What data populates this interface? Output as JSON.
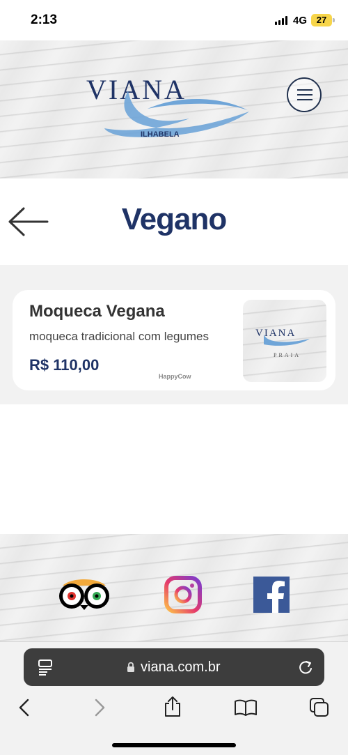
{
  "status_bar": {
    "time": "2:13",
    "network": "4G",
    "battery": "27"
  },
  "header": {
    "logo_text": "VIANA",
    "logo_sub": "ILHABELA",
    "menu_icon": "hamburger-icon"
  },
  "page": {
    "title": "Vegano",
    "back_icon": "arrow-left-icon"
  },
  "items": [
    {
      "name": "Moqueca Vegana",
      "description": "moqueca tradicional com legumes",
      "price": "R$ 110,00",
      "thumb_logo": "VIANA",
      "thumb_sub": "PRAIA",
      "watermark": "HappyCow"
    }
  ],
  "footer": {
    "social": [
      "tripadvisor-icon",
      "instagram-icon",
      "facebook-icon"
    ]
  },
  "browser": {
    "url": "viana.com.br",
    "toolbar": [
      "back-icon",
      "forward-icon",
      "share-icon",
      "bookmarks-icon",
      "tabs-icon"
    ]
  },
  "colors": {
    "brand_navy": "#1f3366",
    "brand_blue": "#6fa5d8",
    "card_bg": "#ffffff",
    "list_bg": "#f2f2f2"
  }
}
